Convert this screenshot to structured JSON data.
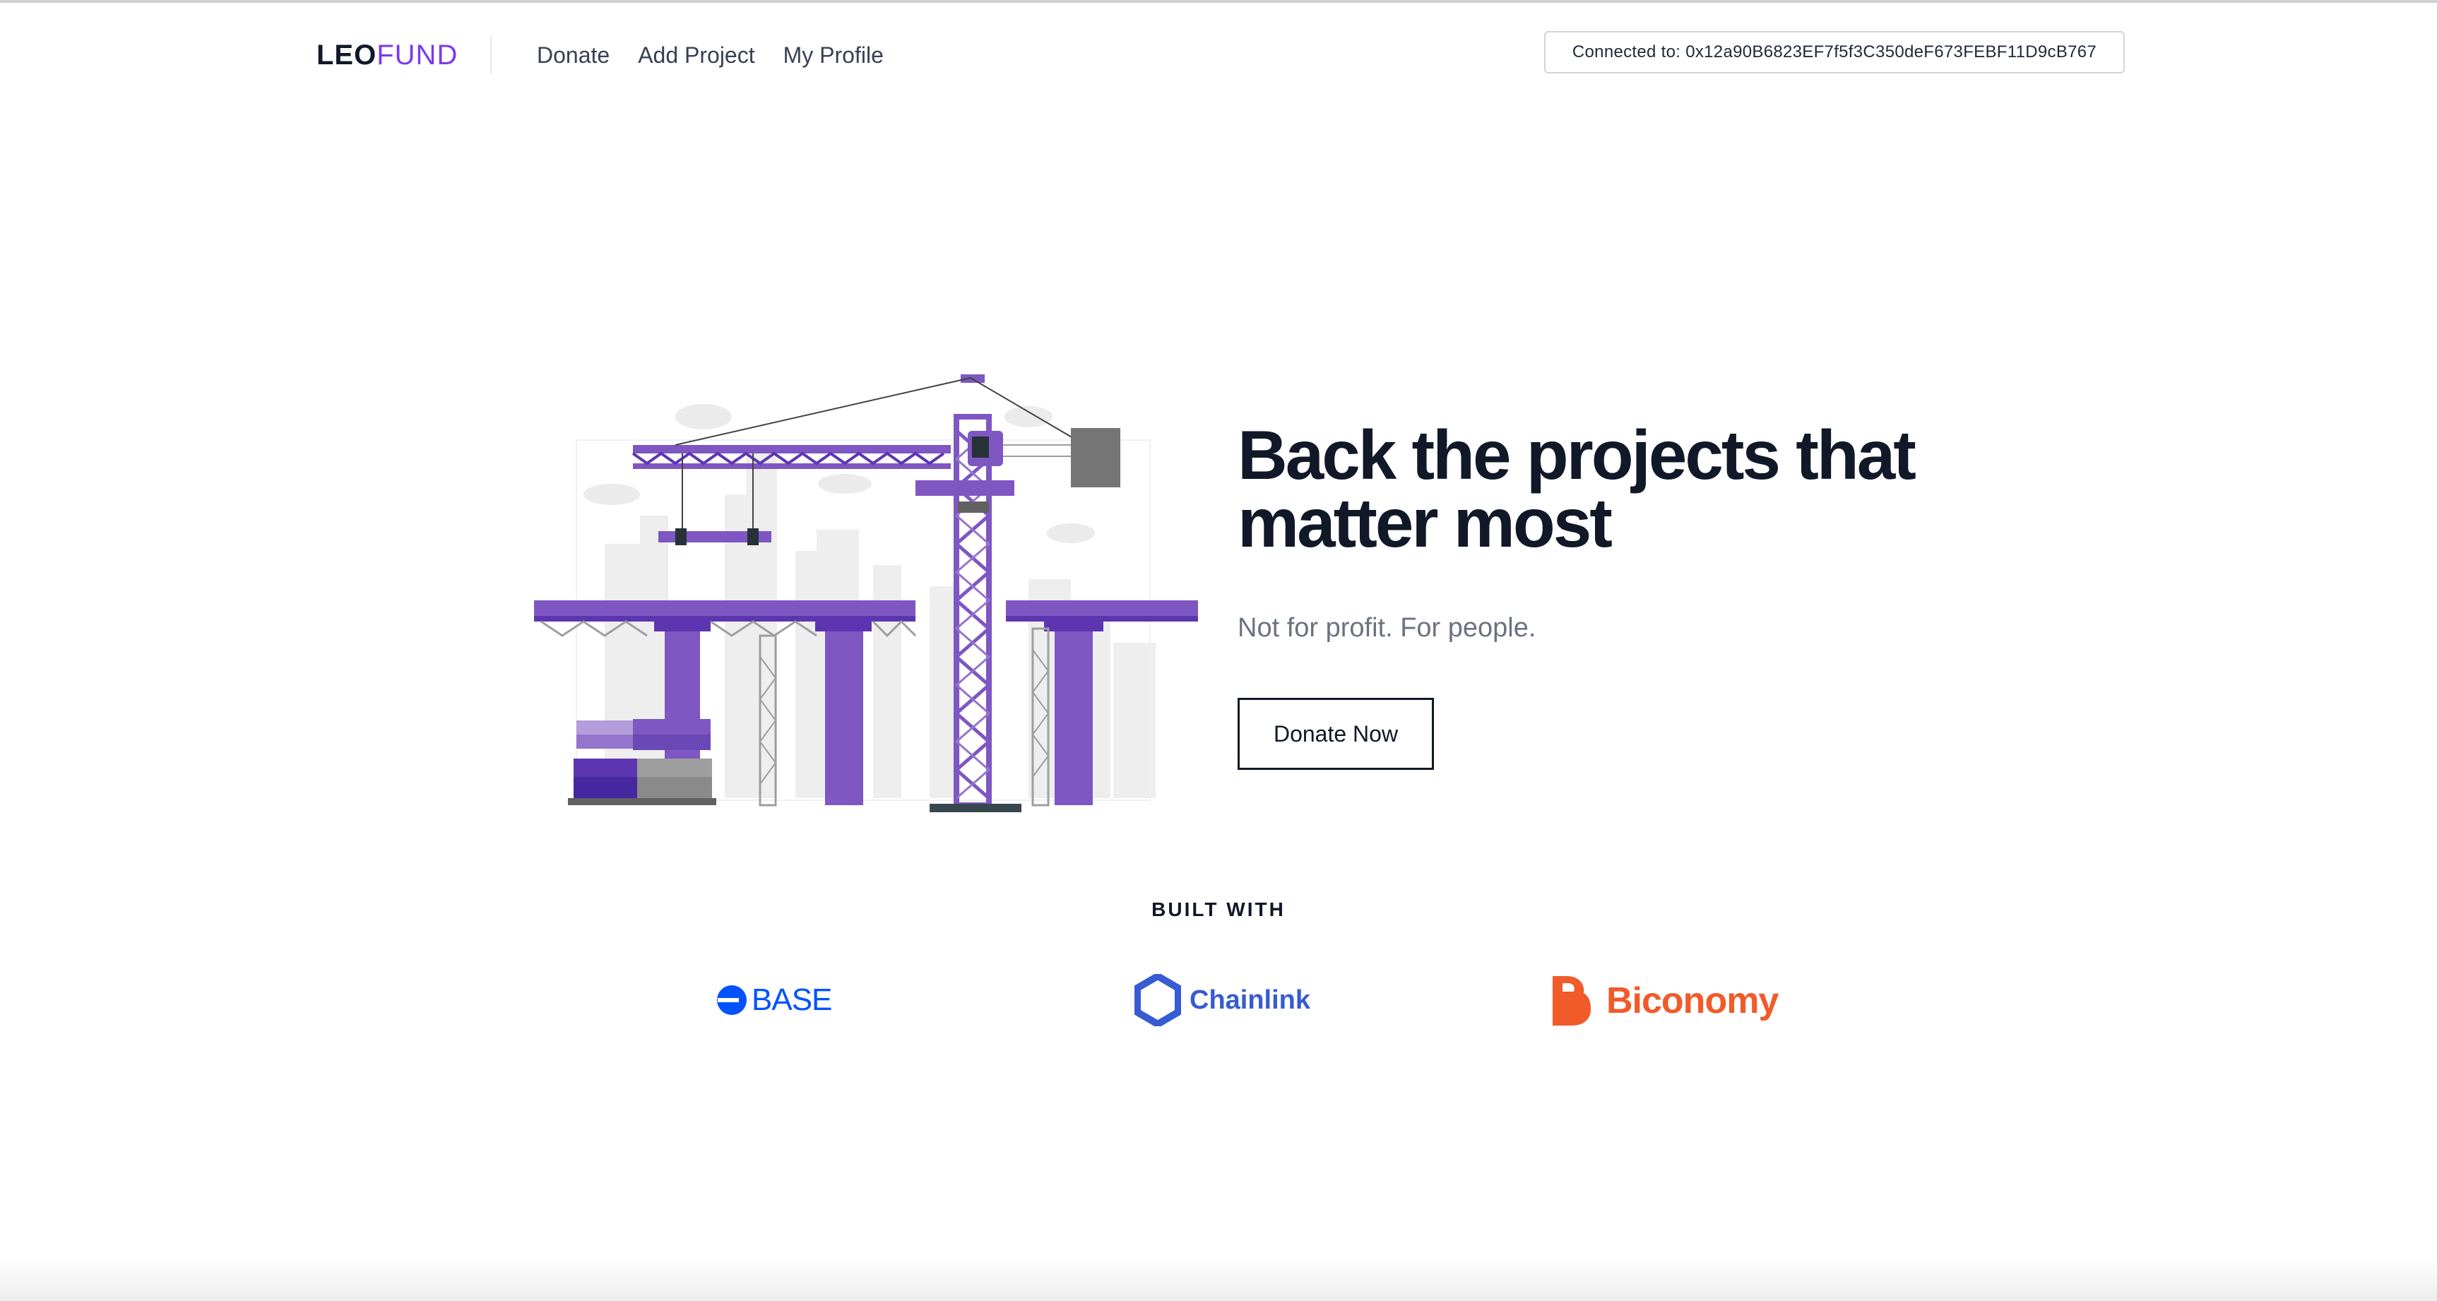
{
  "brand": {
    "logo_part1": "LEO",
    "logo_part2": "FUND",
    "accent": "#7c3aed"
  },
  "nav": {
    "items": [
      "Donate",
      "Add Project",
      "My Profile"
    ]
  },
  "wallet": {
    "text": "Connected to: 0x12a90B6823EF7f5f3C350deF673FEBF11D9cB767"
  },
  "hero": {
    "headline_line1": "Back the projects that",
    "headline_line2": "matter most",
    "subtitle": "Not for profit. For people.",
    "cta_label": "Donate Now",
    "illustration": "crane-construction-illustration"
  },
  "built_with": {
    "title": "BUILT WITH",
    "partners": [
      {
        "name": "BASE",
        "icon": "base-logo-icon",
        "color": "#0052ff"
      },
      {
        "name": "Chainlink",
        "icon": "chainlink-logo-icon",
        "color": "#375bd2"
      },
      {
        "name": "Biconomy",
        "icon": "biconomy-logo-icon",
        "color": "#f15a29"
      }
    ]
  }
}
